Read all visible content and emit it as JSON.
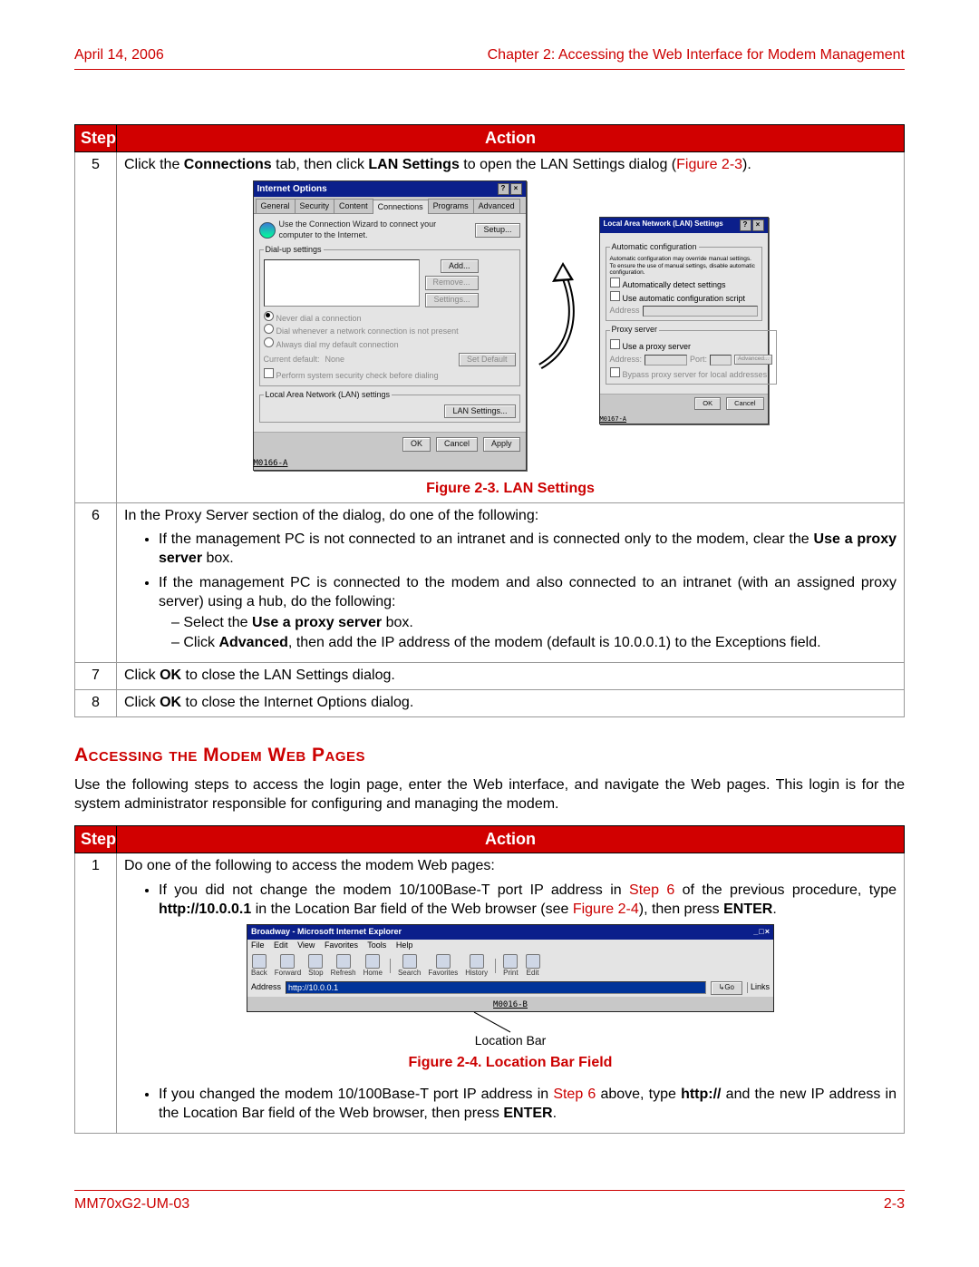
{
  "header": {
    "left": "April 14, 2006",
    "right": "Chapter 2: Accessing the Web Interface for Modem Management"
  },
  "footer": {
    "left": "MM70xG2-UM-03",
    "right": "2-3"
  },
  "table1": {
    "headers": {
      "step": "Step",
      "action": "Action"
    },
    "rows": {
      "5": {
        "num": "5",
        "line_pre": "Click the ",
        "b1": "Connections",
        "mid": " tab, then click ",
        "b2": "LAN Settings",
        "post": " to open the LAN Settings dialog (",
        "figref": "Figure 2-3",
        "end": ")."
      },
      "figcap1": "Figure 2-3. LAN Settings",
      "6": {
        "num": "6",
        "intro": "In the Proxy Server section of the dialog, do one of the following:",
        "b1a": "If the management PC is not connected to an intranet and is connected only to the modem, clear the ",
        "b1b": "Use a proxy server",
        "b1c": " box.",
        "b2": "If the management PC is connected to the modem and also connected to an intranet (with an assigned proxy server) using a hub, do the following:",
        "d1a": "Select the ",
        "d1b": "Use a proxy server",
        "d1c": " box.",
        "d2a": "Click ",
        "d2b": "Advanced",
        "d2c": ", then add the IP address of the modem (default is 10.0.0.1) to the Exceptions field."
      },
      "7": {
        "num": "7",
        "a": "Click ",
        "b": "OK",
        "c": " to close the LAN Settings dialog."
      },
      "8": {
        "num": "8",
        "a": "Click ",
        "b": "OK",
        "c": " to close the Internet Options dialog."
      }
    }
  },
  "section_heading": "Accessing the Modem Web Pages",
  "section_para": "Use the following steps to access the login page, enter the Web interface, and navigate the Web pages. This login is for the system administrator responsible for configuring and managing the modem.",
  "table2": {
    "headers": {
      "step": "Step",
      "action": "Action"
    },
    "rows": {
      "1": {
        "num": "1",
        "intro": "Do one of the following to access the modem Web pages:",
        "b1a": "If you did not change the modem 10/100Base-T port IP address in ",
        "b1link": "Step 6",
        "b1b": " of the previous procedure, type ",
        "b1bold": "http://10.0.0.1",
        "b1c": " in the Location Bar field of the Web browser (see ",
        "b1figref": "Figure 2-4",
        "b1d": "), then press ",
        "b1bold2": "ENTER",
        "b1e": ".",
        "figcap": "Figure 2-4. Location Bar Field",
        "locbar_label": "Location Bar",
        "b2a": "If you changed the modem 10/100Base-T port IP address in ",
        "b2link": "Step 6",
        "b2b": " above, type ",
        "b2bold": "http://",
        "b2c": " and the new IP address in the Location Bar field of the Web browser, then press ",
        "b2bold2": "ENTER",
        "b2d": "."
      }
    }
  },
  "dialogA": {
    "title": "Internet Options",
    "tabs": [
      "General",
      "Security",
      "Content",
      "Connections",
      "Programs",
      "Advanced"
    ],
    "active_tab": "Connections",
    "wizard_text": "Use the Connection Wizard to connect your computer to the Internet.",
    "setup_btn": "Setup...",
    "dialup_legend": "Dial-up settings",
    "add_btn": "Add...",
    "remove_btn": "Remove...",
    "settings_btn": "Settings...",
    "r1": "Never dial a connection",
    "r2": "Dial whenever a network connection is not present",
    "r3": "Always dial my default connection",
    "cur_default_label": "Current default:",
    "cur_default_value": "None",
    "setdefault_btn": "Set Default",
    "perform_cb": "Perform system security check before dialing",
    "lan_legend": "Local Area Network (LAN) settings",
    "lan_btn": "LAN Settings...",
    "ok": "OK",
    "cancel": "Cancel",
    "apply": "Apply",
    "footer_id": "M0166-A"
  },
  "dialogB": {
    "title": "Local Area Network (LAN) Settings",
    "autocfg_legend": "Automatic configuration",
    "autocfg_text": "Automatic configuration may override manual settings. To ensure the use of manual settings, disable automatic configuration.",
    "cb1": "Automatically detect settings",
    "cb2": "Use automatic configuration script",
    "addr_label": "Address",
    "proxy_legend": "Proxy server",
    "proxy_cb": "Use a proxy server",
    "addr2_label": "Address:",
    "port_label": "Port:",
    "adv_btn": "Advanced...",
    "bypass_cb": "Bypass proxy server for local addresses",
    "ok": "OK",
    "cancel": "Cancel",
    "footer_id": "M0167-A"
  },
  "ie": {
    "title": "Broadway - Microsoft Internet Explorer",
    "menu": [
      "File",
      "Edit",
      "View",
      "Favorites",
      "Tools",
      "Help"
    ],
    "toolbar": [
      "Back",
      "Forward",
      "Stop",
      "Refresh",
      "Home",
      "Search",
      "Favorites",
      "History",
      "Print",
      "Edit"
    ],
    "addr_label": "Address",
    "addr_value": "http://10.0.0.1",
    "go": "Go",
    "links": "Links",
    "footer_id": "M0016-B"
  }
}
